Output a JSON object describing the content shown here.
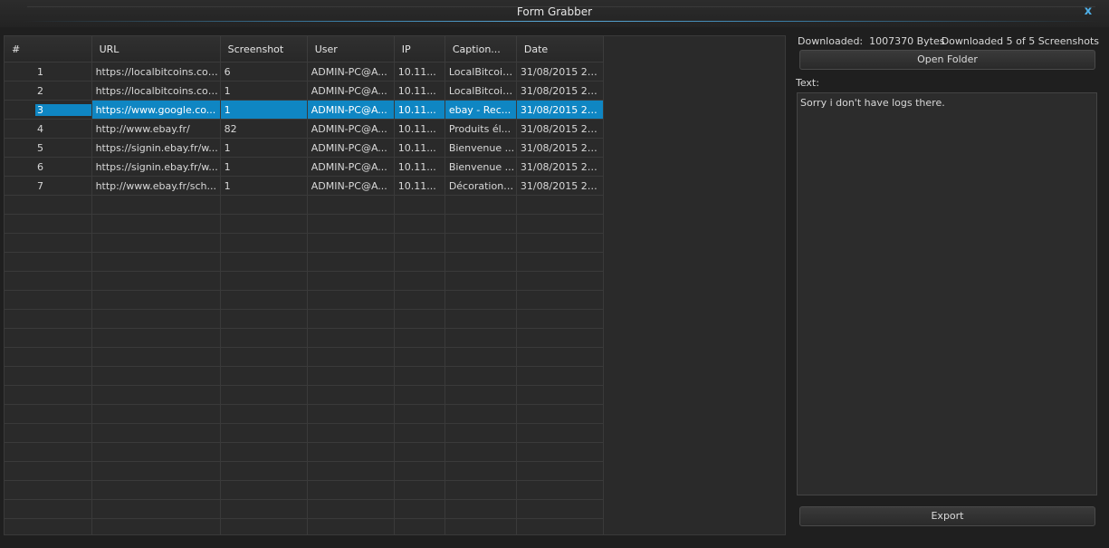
{
  "window": {
    "title": "Form Grabber",
    "close_glyph": "x"
  },
  "table": {
    "columns": [
      "#",
      "URL",
      "Screenshot",
      "User",
      "IP",
      "Caption...",
      "Date"
    ],
    "rows": [
      {
        "num": "1",
        "url": "https://localbitcoins.com...",
        "screenshot": "6",
        "user": "ADMIN-PC@A...",
        "ip": "10.11...",
        "caption": "LocalBitcoin...",
        "date": "31/08/2015 23..."
      },
      {
        "num": "2",
        "url": "https://localbitcoins.com...",
        "screenshot": "1",
        "user": "ADMIN-PC@A...",
        "ip": "10.11...",
        "caption": "LocalBitcoin...",
        "date": "31/08/2015 23..."
      },
      {
        "num": "3",
        "url": "https://www.google.co...",
        "screenshot": "1",
        "user": "ADMIN-PC@A...",
        "ip": "10.11...",
        "caption": "ebay - Rec...",
        "date": "31/08/2015 23..."
      },
      {
        "num": "4",
        "url": "http://www.ebay.fr/",
        "screenshot": "82",
        "user": "ADMIN-PC@A...",
        "ip": "10.11...",
        "caption": "Produits él...",
        "date": "31/08/2015 23..."
      },
      {
        "num": "5",
        "url": "https://signin.ebay.fr/w...",
        "screenshot": "1",
        "user": "ADMIN-PC@A...",
        "ip": "10.11...",
        "caption": "Bienvenue ...",
        "date": "31/08/2015 23..."
      },
      {
        "num": "6",
        "url": "https://signin.ebay.fr/w...",
        "screenshot": "1",
        "user": "ADMIN-PC@A...",
        "ip": "10.11...",
        "caption": "Bienvenue ...",
        "date": "31/08/2015 23..."
      },
      {
        "num": "7",
        "url": "http://www.ebay.fr/sch...",
        "screenshot": "1",
        "user": "ADMIN-PC@A...",
        "ip": "10.11...",
        "caption": "Décoration ...",
        "date": "31/08/2015 23..."
      }
    ],
    "selected_row": "3"
  },
  "side": {
    "downloaded_label": "Downloaded:",
    "downloaded_bytes": "1007370 Bytes",
    "downloaded_count": "Downloaded 5 of  5 Screenshots",
    "open_folder": "Open Folder",
    "text_label": "Text:",
    "text_value": "Sorry i don't have logs there.",
    "export": "Export"
  },
  "colors": {
    "accent": "#0f86c3",
    "close": "#4fb0e8",
    "background": "#1f1f1f"
  }
}
